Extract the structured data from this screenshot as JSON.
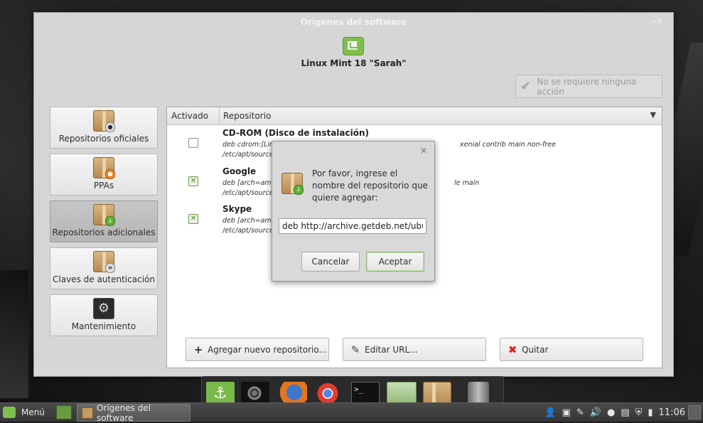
{
  "window": {
    "title": "Orígenes del software",
    "distro": "Linux Mint 18 \"Sarah\""
  },
  "status_button": {
    "label": "No se requiere ninguna acción"
  },
  "sidebar": {
    "items": [
      {
        "label": "Repositorios oficiales",
        "icon": "package-official-icon"
      },
      {
        "label": "PPAs",
        "icon": "package-ppa-icon"
      },
      {
        "label": "Repositorios adicionales",
        "icon": "package-add-icon"
      },
      {
        "label": "Claves de autenticación",
        "icon": "package-key-icon"
      },
      {
        "label": "Mantenimiento",
        "icon": "maintenance-icon"
      }
    ]
  },
  "table": {
    "columns": [
      "Activado",
      "Repositorio"
    ],
    "rows": [
      {
        "enabled": false,
        "name": "CD-ROM (Disco de instalación)",
        "line1": "deb cdrom:[Lin",
        "line1_end": "xenial contrib main non-free",
        "line2": "/etc/apt/source"
      },
      {
        "enabled": true,
        "name": "Google",
        "line1": "deb [arch=ama",
        "line1_end": "le main",
        "line2": "/etc/apt/source"
      },
      {
        "enabled": true,
        "name": "Skype",
        "line1": "deb [arch=ama",
        "line1_end": "",
        "line2": "/etc/apt/source"
      }
    ]
  },
  "buttons": {
    "add": "Agregar nuevo repositorio...",
    "edit": "Editar URL...",
    "quit": "Quitar"
  },
  "dialog": {
    "message": "Por favor, ingrese el nombre del repositorio que quiere agregar:",
    "input_value": "deb http://archive.getdeb.net/ubuntu",
    "cancel": "Cancelar",
    "accept": "Aceptar"
  },
  "taskbar": {
    "menu": "Menú",
    "task": "Orígenes del software",
    "clock": "11:06"
  }
}
